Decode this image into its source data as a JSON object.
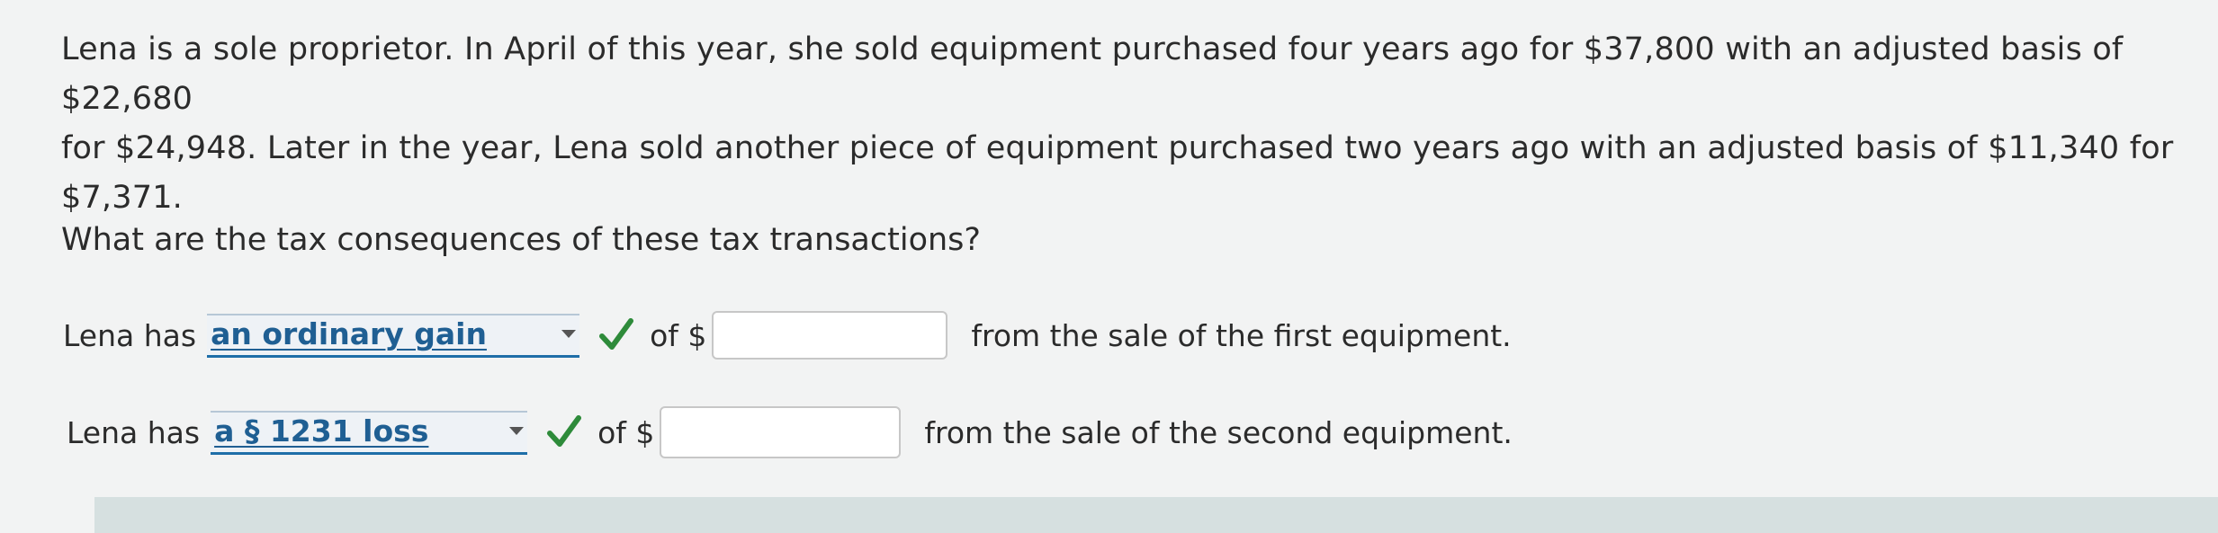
{
  "question": {
    "line1": "Lena is a sole proprietor. In April of this year, she sold equipment purchased four years ago for $37,800 with an adjusted basis of $22,680",
    "line2": "for $24,948. Later in the year, Lena sold another piece of equipment purchased two years ago with an adjusted basis of $11,340 for",
    "line3": "$7,371.",
    "prompt": "What are the tax consequences of these tax transactions?"
  },
  "answers": [
    {
      "lead": "Lena has",
      "selected": "an ordinary gain",
      "of_label": "of $",
      "amount": "",
      "trail": "from the sale of the first equipment.",
      "check_color": "#2e8b3a"
    },
    {
      "lead": "Lena has",
      "selected": "a § 1231 loss",
      "of_label": "of $",
      "amount": "",
      "trail": "from the sale of the second equipment.",
      "check_color": "#2e8b3a"
    }
  ]
}
